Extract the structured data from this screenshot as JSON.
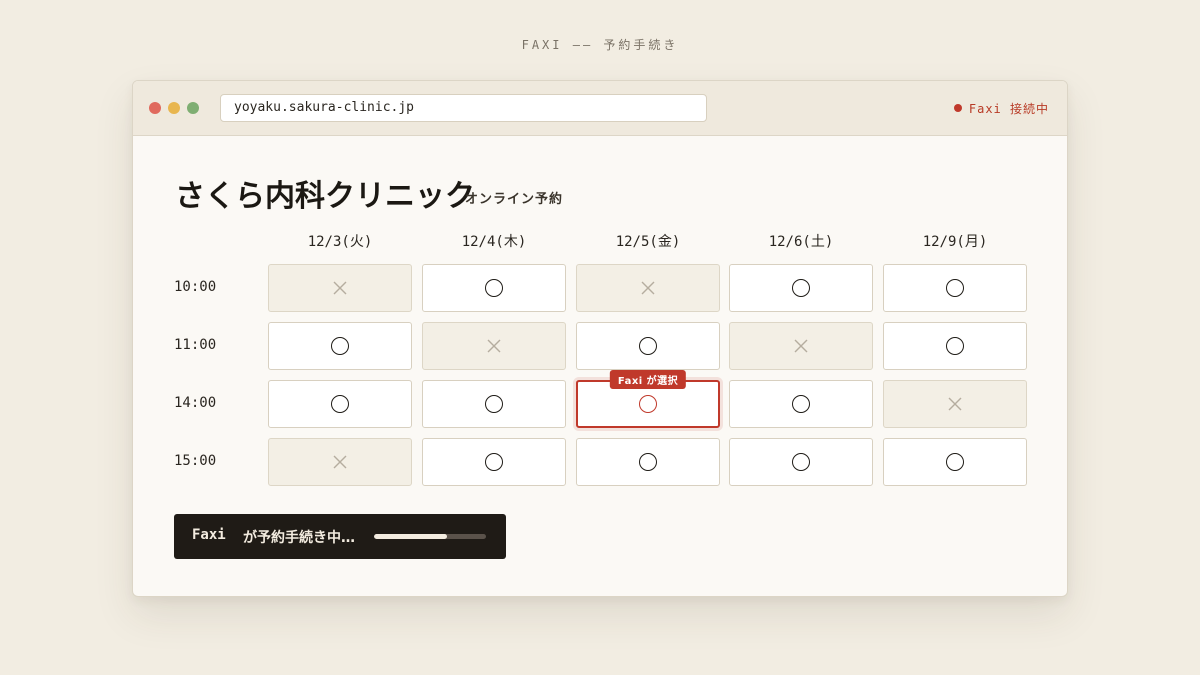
{
  "page_header": "FAXI —— 予約手続き",
  "browser": {
    "url": "yoyaku.sakura-clinic.jp",
    "status": "Faxi 接続中"
  },
  "clinic": {
    "name": "さくら内科クリニック",
    "subtitle": "オンライン予約"
  },
  "schedule": {
    "days": [
      "12/3(火)",
      "12/4(木)",
      "12/5(金)",
      "12/6(土)",
      "12/9(月)"
    ],
    "times": [
      "10:00",
      "11:00",
      "14:00",
      "15:00"
    ],
    "slots": [
      [
        "×",
        "○",
        "×",
        "○",
        "○"
      ],
      [
        "○",
        "×",
        "○",
        "×",
        "○"
      ],
      [
        "○",
        "○",
        "○",
        "○",
        "×"
      ],
      [
        "×",
        "○",
        "○",
        "○",
        "○"
      ]
    ],
    "selected": {
      "row": 2,
      "col": 2,
      "label": "Faxi が選択"
    }
  },
  "progress": {
    "agent": "Faxi",
    "text": "が予約手続き中…",
    "fraction": 0.65
  },
  "colors": {
    "accent": "#c0392b",
    "background": "#f2ede2",
    "panel": "#1f1b16"
  },
  "icons": {
    "available": "circle-icon",
    "unavailable": "cross-icon",
    "status": "status-dot-icon"
  }
}
